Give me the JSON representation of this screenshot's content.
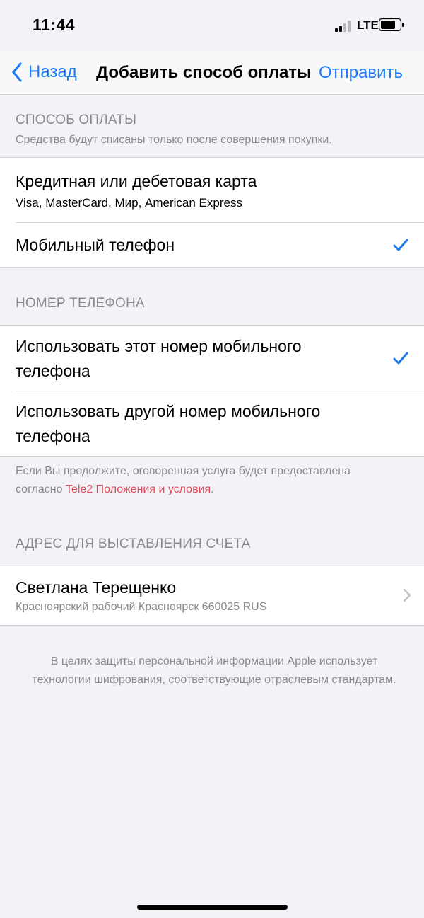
{
  "status": {
    "time": "11:44",
    "network": "LTE"
  },
  "nav": {
    "back_label": "Назад",
    "title": "Добавить способ оплаты",
    "send_label": "Отправить"
  },
  "payment": {
    "header": "СПОСОБ ОПЛАТЫ",
    "note": "Средства будут списаны только после совершения покупки.",
    "options": [
      {
        "title": "Кредитная или дебетовая карта",
        "subtitle": "Visa, MasterCard, Мир, American Express",
        "selected": false
      },
      {
        "title": "Мобильный телефон",
        "selected": true
      }
    ]
  },
  "phone": {
    "header": "НОМЕР ТЕЛЕФОНА",
    "options": [
      {
        "title_line1": "Использовать этот номер мобильного",
        "title_line2": "телефона",
        "selected": true
      },
      {
        "title_line1": "Использовать другой номер мобильного",
        "title_line2": "телефона",
        "selected": false
      }
    ],
    "terms_line1": "Если Вы продолжите, оговоренная услуга будет предоставлена",
    "terms_line2_prefix": "согласно ",
    "terms_link": "Tele2 Положения и условия",
    "terms_line2_suffix": "."
  },
  "billing": {
    "header": "АДРЕС ДЛЯ ВЫСТАВЛЕНИЯ СЧЕТА",
    "name": "Светлана Терещенко",
    "address": "Красноярский рабочий Красноярск 660025 RUS"
  },
  "privacy_note": "В целях защиты персональной информации Apple использует технологии шифрования, соответствующие отраслевым стандартам.",
  "colors": {
    "accent": "#1f7af5",
    "link": "#e04a5a",
    "background": "#f2f2f7"
  }
}
